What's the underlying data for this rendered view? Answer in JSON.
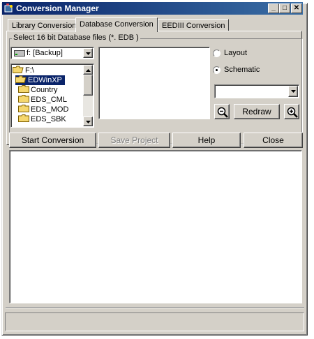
{
  "window": {
    "title": "Conversion Manager",
    "minimize": "_",
    "maximize": "□",
    "close": "✕"
  },
  "tabs": [
    {
      "label": "Library Conversion",
      "active": false
    },
    {
      "label": "Database Conversion",
      "active": true
    },
    {
      "label": "EEDIII Conversion",
      "active": false
    }
  ],
  "group": {
    "label": "Select 16 bit Database files (*. EDB )"
  },
  "drive_combo": {
    "value": "f: [Backup]"
  },
  "tree": {
    "items": [
      {
        "label": "F:\\",
        "icon": "open-folder-icon",
        "selected": false
      },
      {
        "label": "EDWinXP",
        "icon": "open-folder-icon",
        "selected": true
      },
      {
        "label": "Country",
        "icon": "folder-icon",
        "selected": false
      },
      {
        "label": "EDS_CML",
        "icon": "folder-icon",
        "selected": false
      },
      {
        "label": "EDS_MOD",
        "icon": "folder-icon",
        "selected": false
      },
      {
        "label": "EDS_SBK",
        "icon": "folder-icon",
        "selected": false
      }
    ]
  },
  "options": {
    "layout_label": "Layout",
    "schematic_label": "Schematic",
    "selected": "Schematic"
  },
  "view_combo": {
    "value": ""
  },
  "zoom": {
    "redraw_label": "Redraw",
    "zoom_out_icon": "zoom-out-icon",
    "zoom_in_icon": "zoom-in-icon"
  },
  "actions": {
    "start": "Start Conversion",
    "save": "Save Project",
    "save_enabled": false,
    "help": "Help",
    "close": "Close"
  },
  "status": {
    "text": ""
  },
  "colors": {
    "title_start": "#0a246a",
    "title_end": "#3a6ea5",
    "face": "#d4d0c8",
    "selection": "#0a246a",
    "folder": "#f5d76e"
  }
}
